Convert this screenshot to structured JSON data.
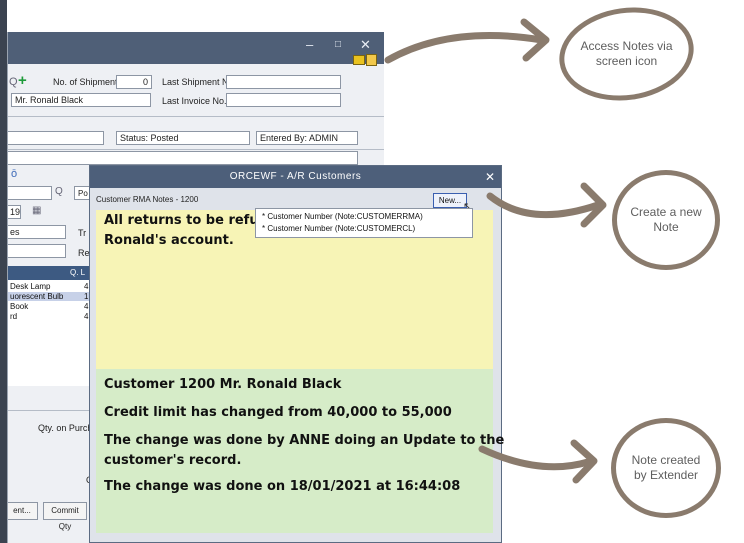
{
  "background_window": {
    "title_buttons": [
      "–",
      "□",
      "✕"
    ],
    "shipments_label": "No. of Shipments",
    "shipments_value": "0",
    "last_shipment_label": "Last Shipment No.",
    "customer_name": "Mr. Ronald Black",
    "last_invoice_label": "Last Invoice No.",
    "status_text": "Status: Posted",
    "entered_by_text": "Entered By: ADMIN",
    "partial_labels": [
      "Po",
      "Tr",
      "Re"
    ],
    "date_fragment": "19",
    "field_fragment": "es",
    "grid_header": "Q. L",
    "grid_rows": [
      {
        "item": "Desk Lamp",
        "qty": "4"
      },
      {
        "item": "uorescent Bulb",
        "qty": "1"
      },
      {
        "item": "Book",
        "qty": "4"
      },
      {
        "item": "rd",
        "qty": "4"
      }
    ],
    "qty_on_purchase_label": "Qty. on Purchas",
    "button_ent": "ent...",
    "button_commit": "Commit Qty",
    "fragment_d": "[",
    "fragment_c": "C"
  },
  "popup": {
    "title": "ORCEWF - A/R Customers",
    "close": "✕",
    "notes_header": "Customer RMA Notes - 1200",
    "new_button": "New...",
    "menu_items": [
      "* Customer Number (Note:CUSTOMERRMA)",
      "* Customer Number (Note:CUSTOMERCL)"
    ],
    "note1_line1": "All returns to be refundec",
    "note1_line2": "Ronald's account.",
    "note2_lines": [
      "Customer 1200 Mr. Ronald Black",
      "Credit limit has changed from 40,000 to 55,000",
      "The change was done by ANNE doing an Update to the",
      "customer's record.",
      "The change was done on 18/01/2021 at 16:44:08"
    ]
  },
  "callouts": {
    "access_notes": "Access Notes via screen icon",
    "create_note": "Create a new Note",
    "note_created": "Note created by Extender"
  },
  "colors": {
    "callout_ring": "#8a7b6d",
    "yellow_note": "#f7f4b6",
    "green_note": "#d6ecc8",
    "title_bar": "#4d5f7a"
  }
}
